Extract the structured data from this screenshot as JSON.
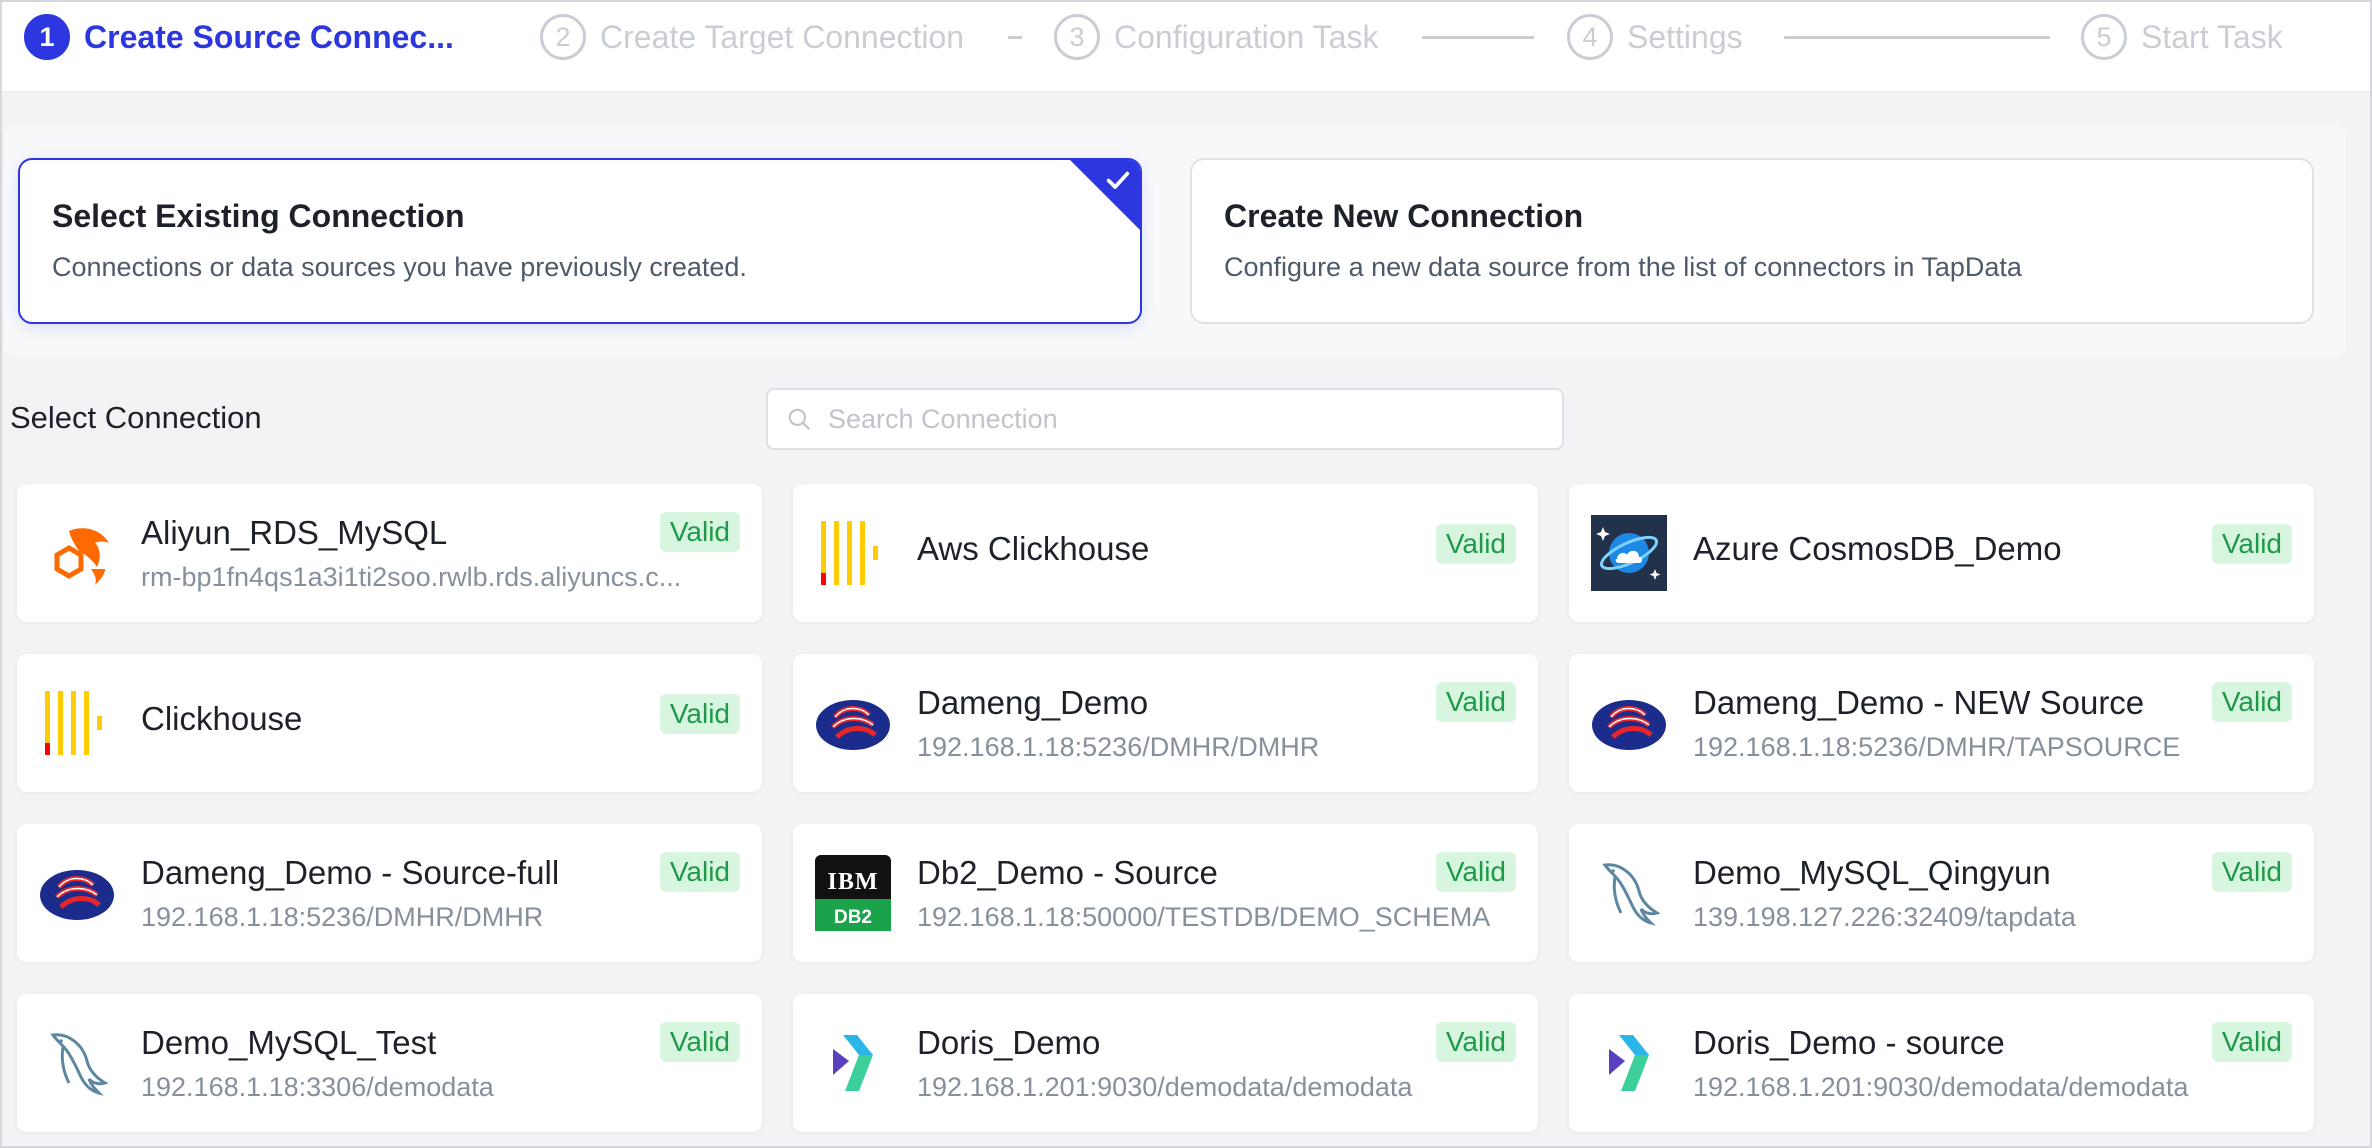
{
  "steps": [
    {
      "num": "1",
      "label": "Create Source Connec...",
      "active": true
    },
    {
      "num": "2",
      "label": "Create Target Connection",
      "active": false
    },
    {
      "num": "3",
      "label": "Configuration Task",
      "active": false
    },
    {
      "num": "4",
      "label": "Settings",
      "active": false
    },
    {
      "num": "5",
      "label": "Start Task",
      "active": false
    }
  ],
  "options": {
    "existing": {
      "title": "Select Existing Connection",
      "desc": "Connections or data sources you have previously created."
    },
    "new": {
      "title": "Create New Connection",
      "desc": "Configure a new data source from the list of connectors in TapData"
    }
  },
  "select": {
    "label": "Select Connection",
    "search_placeholder": "Search Connection"
  },
  "colors": {
    "accent": "#2c37e0",
    "valid_bg": "#d8f5e0",
    "valid_text": "#1f9a4a"
  },
  "connections": [
    {
      "name": "Aliyun_RDS_MySQL",
      "address": "rm-bp1fn4qs1a3i1ti2soo.rwlb.rds.aliyuncs.c...",
      "status": "Valid",
      "icon": "aliyun-dolphin-icon"
    },
    {
      "name": "Aws Clickhouse",
      "address": "",
      "status": "Valid",
      "icon": "clickhouse-icon"
    },
    {
      "name": "Azure CosmosDB_Demo",
      "address": "",
      "status": "Valid",
      "icon": "cosmosdb-icon"
    },
    {
      "name": "Clickhouse",
      "address": "",
      "status": "Valid",
      "icon": "clickhouse-icon"
    },
    {
      "name": "Dameng_Demo",
      "address": "192.168.1.18:5236/DMHR/DMHR",
      "status": "Valid",
      "icon": "dameng-icon"
    },
    {
      "name": "Dameng_Demo - NEW Source",
      "address": "192.168.1.18:5236/DMHR/TAPSOURCE",
      "status": "Valid",
      "icon": "dameng-icon"
    },
    {
      "name": "Dameng_Demo - Source-full",
      "address": "192.168.1.18:5236/DMHR/DMHR",
      "status": "Valid",
      "icon": "dameng-icon"
    },
    {
      "name": "Db2_Demo - Source",
      "address": "192.168.1.18:50000/TESTDB/DEMO_SCHEMA",
      "status": "Valid",
      "icon": "ibm-db2-icon",
      "logo_text_top": "IBM",
      "logo_text_bottom": "DB2"
    },
    {
      "name": "Demo_MySQL_Qingyun",
      "address": "139.198.127.226:32409/tapdata",
      "status": "Valid",
      "icon": "mysql-dolphin-icon"
    },
    {
      "name": "Demo_MySQL_Test",
      "address": "192.168.1.18:3306/demodata",
      "status": "Valid",
      "icon": "mysql-dolphin-icon"
    },
    {
      "name": "Doris_Demo",
      "address": "192.168.1.201:9030/demodata/demodata",
      "status": "Valid",
      "icon": "doris-icon"
    },
    {
      "name": "Doris_Demo - source",
      "address": "192.168.1.201:9030/demodata/demodata",
      "status": "Valid",
      "icon": "doris-icon"
    }
  ]
}
